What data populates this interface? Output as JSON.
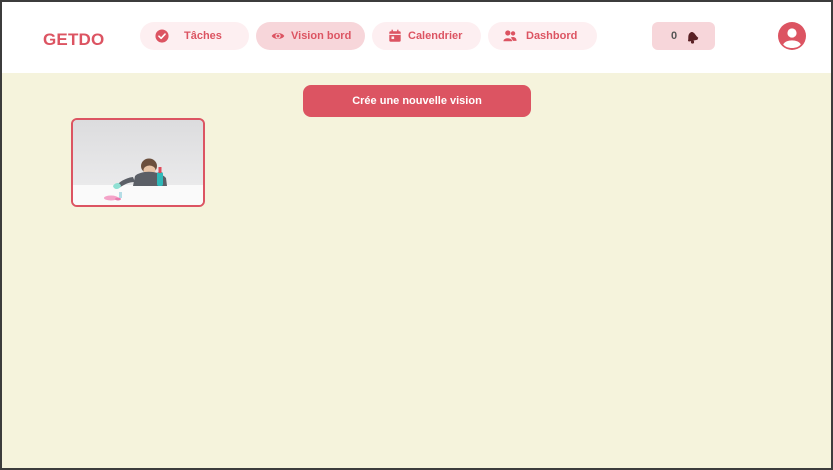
{
  "app": {
    "logo": "GETDO"
  },
  "nav": {
    "items": [
      {
        "label": "Tâches",
        "icon": "check-circle-icon",
        "active": false
      },
      {
        "label": "Vision bord",
        "icon": "eye-icon",
        "active": true
      },
      {
        "label": "Calendrier",
        "icon": "calendar-icon",
        "active": false
      },
      {
        "label": "Dashbord",
        "icon": "users-icon",
        "active": false
      }
    ]
  },
  "notifications": {
    "count": "0",
    "icon": "bell-icon"
  },
  "account": {
    "icon": "user-circle-icon"
  },
  "main": {
    "create_button_label": "Crée une nouvelle vision",
    "visions": [
      {
        "image_alt": "vision-image",
        "icon": "photo"
      }
    ]
  },
  "colors": {
    "accent": "#dc5462",
    "nav_bg": "#fdeff1",
    "nav_active_bg": "#f7d6da",
    "content_bg": "#f5f3dc"
  }
}
